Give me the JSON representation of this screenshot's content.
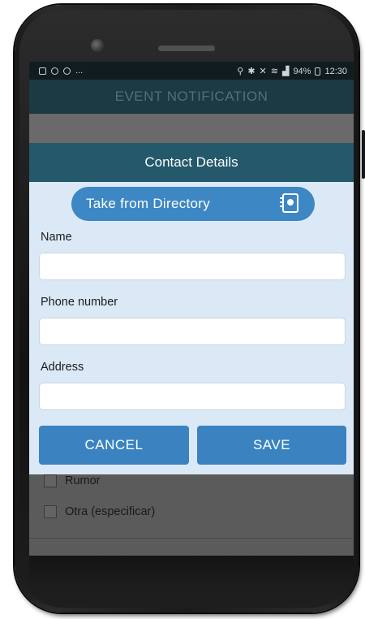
{
  "status_bar": {
    "left_dots": "...",
    "battery": "94%",
    "time": "12:30"
  },
  "app": {
    "title": "EVENT NOTIFICATION"
  },
  "dialog": {
    "title": "Contact Details",
    "directory_button": "Take from Directory",
    "directory_icon": "contacts-book-icon",
    "fields": [
      {
        "label": "Name",
        "value": "",
        "placeholder": ""
      },
      {
        "label": "Phone number",
        "value": "",
        "placeholder": ""
      },
      {
        "label": "Address",
        "value": "",
        "placeholder": ""
      }
    ],
    "cancel_label": "CANCEL",
    "save_label": "SAVE"
  },
  "background_form": {
    "options": [
      {
        "label": "Rumor",
        "checked": false
      },
      {
        "label": "Otra (especificar)",
        "checked": false
      }
    ]
  },
  "colors": {
    "header_bg": "#1b3a43",
    "dialog_header_bg": "#24586b",
    "dialog_bg": "#dbe9f7",
    "button_blue": "#3b83c0"
  }
}
